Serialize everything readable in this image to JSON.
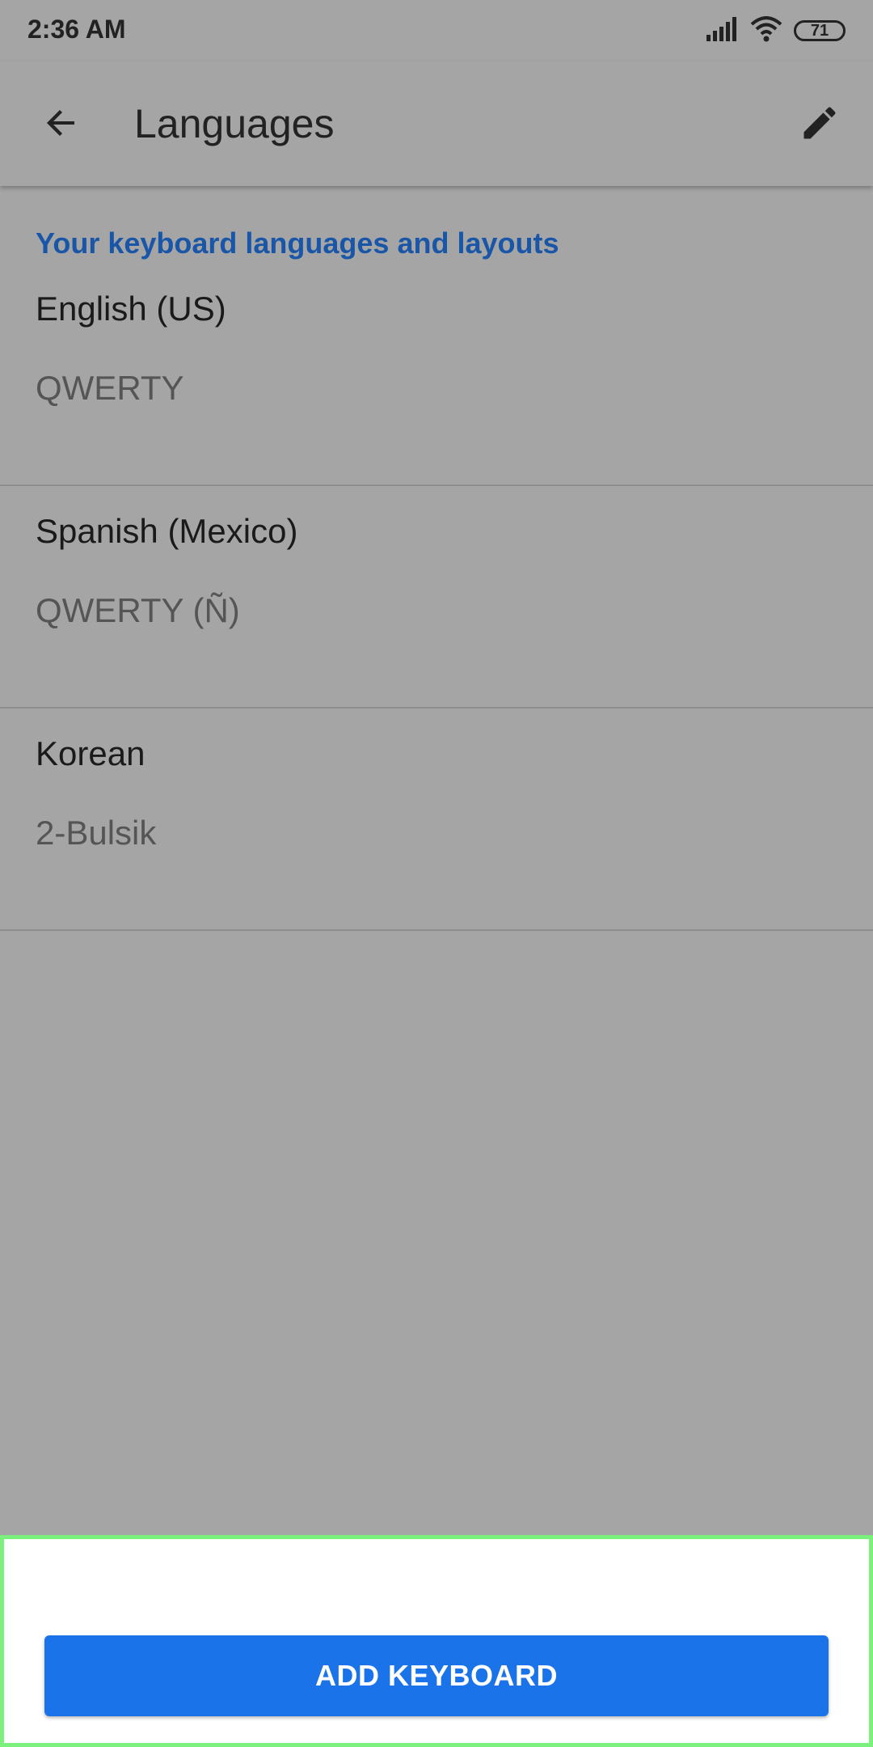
{
  "status_bar": {
    "time": "2:36 AM",
    "battery_level": "71",
    "icons": [
      "signal-icon",
      "wifi-icon",
      "battery-icon"
    ]
  },
  "app_bar": {
    "title": "Languages",
    "back_icon": "arrow-back-icon",
    "edit_icon": "pencil-edit-icon"
  },
  "section": {
    "header": "Your keyboard languages and layouts"
  },
  "languages": [
    {
      "name": "English (US)",
      "layout": "QWERTY"
    },
    {
      "name": "Spanish (Mexico)",
      "layout": "QWERTY (Ñ)"
    },
    {
      "name": "Korean",
      "layout": "2-Bulsik"
    }
  ],
  "actions": {
    "add_keyboard_label": "ADD KEYBOARD"
  },
  "colors": {
    "accent": "#1a73e8",
    "section_header": "#1a56a8",
    "highlight_border": "#7cf07c"
  }
}
